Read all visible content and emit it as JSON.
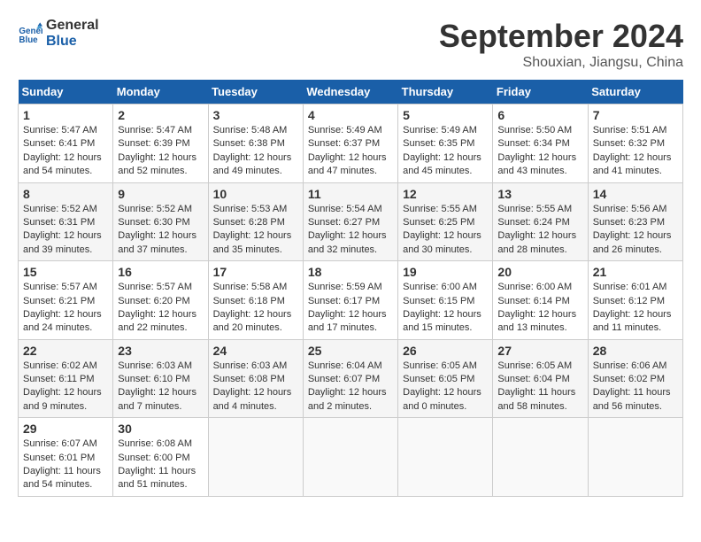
{
  "header": {
    "logo_general": "General",
    "logo_blue": "Blue",
    "month_title": "September 2024",
    "location": "Shouxian, Jiangsu, China"
  },
  "calendar": {
    "days_of_week": [
      "Sunday",
      "Monday",
      "Tuesday",
      "Wednesday",
      "Thursday",
      "Friday",
      "Saturday"
    ],
    "weeks": [
      [
        {
          "day": "",
          "info": ""
        },
        {
          "day": "2",
          "info": "Sunrise: 5:47 AM\nSunset: 6:39 PM\nDaylight: 12 hours\nand 52 minutes."
        },
        {
          "day": "3",
          "info": "Sunrise: 5:48 AM\nSunset: 6:38 PM\nDaylight: 12 hours\nand 49 minutes."
        },
        {
          "day": "4",
          "info": "Sunrise: 5:49 AM\nSunset: 6:37 PM\nDaylight: 12 hours\nand 47 minutes."
        },
        {
          "day": "5",
          "info": "Sunrise: 5:49 AM\nSunset: 6:35 PM\nDaylight: 12 hours\nand 45 minutes."
        },
        {
          "day": "6",
          "info": "Sunrise: 5:50 AM\nSunset: 6:34 PM\nDaylight: 12 hours\nand 43 minutes."
        },
        {
          "day": "7",
          "info": "Sunrise: 5:51 AM\nSunset: 6:32 PM\nDaylight: 12 hours\nand 41 minutes."
        }
      ],
      [
        {
          "day": "8",
          "info": "Sunrise: 5:52 AM\nSunset: 6:31 PM\nDaylight: 12 hours\nand 39 minutes."
        },
        {
          "day": "9",
          "info": "Sunrise: 5:52 AM\nSunset: 6:30 PM\nDaylight: 12 hours\nand 37 minutes."
        },
        {
          "day": "10",
          "info": "Sunrise: 5:53 AM\nSunset: 6:28 PM\nDaylight: 12 hours\nand 35 minutes."
        },
        {
          "day": "11",
          "info": "Sunrise: 5:54 AM\nSunset: 6:27 PM\nDaylight: 12 hours\nand 32 minutes."
        },
        {
          "day": "12",
          "info": "Sunrise: 5:55 AM\nSunset: 6:25 PM\nDaylight: 12 hours\nand 30 minutes."
        },
        {
          "day": "13",
          "info": "Sunrise: 5:55 AM\nSunset: 6:24 PM\nDaylight: 12 hours\nand 28 minutes."
        },
        {
          "day": "14",
          "info": "Sunrise: 5:56 AM\nSunset: 6:23 PM\nDaylight: 12 hours\nand 26 minutes."
        }
      ],
      [
        {
          "day": "15",
          "info": "Sunrise: 5:57 AM\nSunset: 6:21 PM\nDaylight: 12 hours\nand 24 minutes."
        },
        {
          "day": "16",
          "info": "Sunrise: 5:57 AM\nSunset: 6:20 PM\nDaylight: 12 hours\nand 22 minutes."
        },
        {
          "day": "17",
          "info": "Sunrise: 5:58 AM\nSunset: 6:18 PM\nDaylight: 12 hours\nand 20 minutes."
        },
        {
          "day": "18",
          "info": "Sunrise: 5:59 AM\nSunset: 6:17 PM\nDaylight: 12 hours\nand 17 minutes."
        },
        {
          "day": "19",
          "info": "Sunrise: 6:00 AM\nSunset: 6:15 PM\nDaylight: 12 hours\nand 15 minutes."
        },
        {
          "day": "20",
          "info": "Sunrise: 6:00 AM\nSunset: 6:14 PM\nDaylight: 12 hours\nand 13 minutes."
        },
        {
          "day": "21",
          "info": "Sunrise: 6:01 AM\nSunset: 6:12 PM\nDaylight: 12 hours\nand 11 minutes."
        }
      ],
      [
        {
          "day": "22",
          "info": "Sunrise: 6:02 AM\nSunset: 6:11 PM\nDaylight: 12 hours\nand 9 minutes."
        },
        {
          "day": "23",
          "info": "Sunrise: 6:03 AM\nSunset: 6:10 PM\nDaylight: 12 hours\nand 7 minutes."
        },
        {
          "day": "24",
          "info": "Sunrise: 6:03 AM\nSunset: 6:08 PM\nDaylight: 12 hours\nand 4 minutes."
        },
        {
          "day": "25",
          "info": "Sunrise: 6:04 AM\nSunset: 6:07 PM\nDaylight: 12 hours\nand 2 minutes."
        },
        {
          "day": "26",
          "info": "Sunrise: 6:05 AM\nSunset: 6:05 PM\nDaylight: 12 hours\nand 0 minutes."
        },
        {
          "day": "27",
          "info": "Sunrise: 6:05 AM\nSunset: 6:04 PM\nDaylight: 11 hours\nand 58 minutes."
        },
        {
          "day": "28",
          "info": "Sunrise: 6:06 AM\nSunset: 6:02 PM\nDaylight: 11 hours\nand 56 minutes."
        }
      ],
      [
        {
          "day": "29",
          "info": "Sunrise: 6:07 AM\nSunset: 6:01 PM\nDaylight: 11 hours\nand 54 minutes."
        },
        {
          "day": "30",
          "info": "Sunrise: 6:08 AM\nSunset: 6:00 PM\nDaylight: 11 hours\nand 51 minutes."
        },
        {
          "day": "",
          "info": ""
        },
        {
          "day": "",
          "info": ""
        },
        {
          "day": "",
          "info": ""
        },
        {
          "day": "",
          "info": ""
        },
        {
          "day": "",
          "info": ""
        }
      ]
    ],
    "first_week_sunday": {
      "day": "1",
      "info": "Sunrise: 5:47 AM\nSunset: 6:41 PM\nDaylight: 12 hours\nand 54 minutes."
    }
  }
}
